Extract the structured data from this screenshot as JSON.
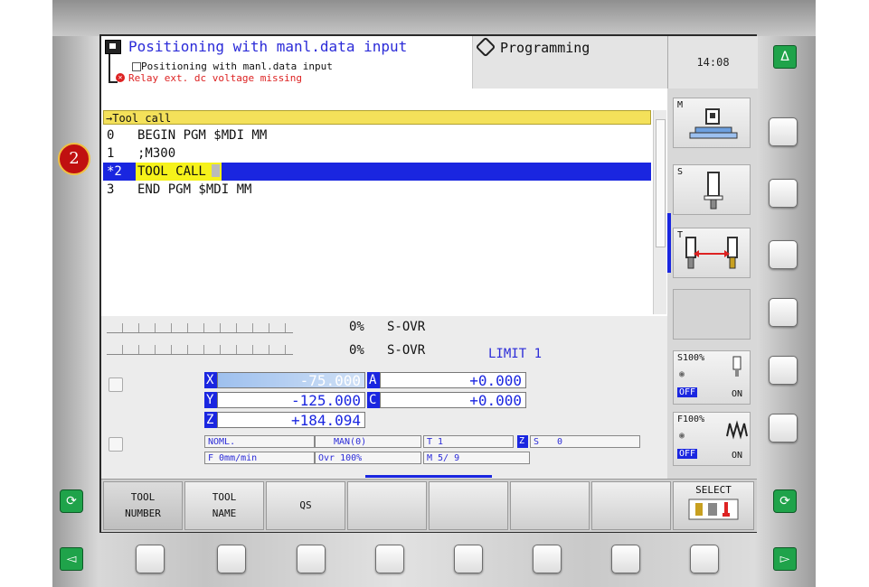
{
  "header": {
    "title": "Positioning with manl.data input",
    "subtitle": "Positioning with manl.data input",
    "error": "Relay ext. dc voltage missing",
    "mode": "Programming",
    "clock": "14:08"
  },
  "badge": "2",
  "editor": {
    "header": "→Tool call",
    "lines": [
      {
        "num": "0",
        "code": "BEGIN PGM $MDI MM"
      },
      {
        "num": "1",
        "code": ";M300"
      },
      {
        "num": "*2",
        "code": "TOOL CALL"
      },
      {
        "num": "3",
        "code": "END PGM $MDI MM"
      }
    ]
  },
  "override": {
    "row1_pct": "0%",
    "row1_label": "S-OVR",
    "row2_pct": "0%",
    "row2_label": "S-OVR",
    "limit": "LIMIT 1"
  },
  "axes": [
    {
      "axis": "X",
      "value": "-75.000"
    },
    {
      "axis": "Y",
      "value": "-125.000"
    },
    {
      "axis": "Z",
      "value": "+184.094"
    },
    {
      "axis": "A",
      "value": "+0.000"
    },
    {
      "axis": "C",
      "value": "+0.000"
    }
  ],
  "status": {
    "noml": "NOML.",
    "man": "MAN(0)",
    "tool": "T 1",
    "zaxis": "Z",
    "spindle": "S",
    "spindle_val": "0",
    "feed": "F 0mm/min",
    "ovr": "Ovr 100%",
    "m": "M 5/ 9"
  },
  "side": {
    "m_key": "M",
    "s_key": "S",
    "t_key": "T",
    "s_pct": "S100%",
    "f_pct": "F100%",
    "off": "OFF",
    "on": "ON"
  },
  "softkeys": [
    {
      "l1": "TOOL",
      "l2": "NUMBER"
    },
    {
      "l1": "TOOL",
      "l2": "NAME"
    },
    {
      "l1": "QS",
      "l2": ""
    },
    {
      "l1": "",
      "l2": ""
    },
    {
      "l1": "",
      "l2": ""
    },
    {
      "l1": "",
      "l2": ""
    },
    {
      "l1": "",
      "l2": ""
    }
  ],
  "select_label": "SELECT",
  "hw_glyphs": {
    "up": "Δ",
    "left": "◅",
    "right": "▻",
    "cycle": "⟳"
  },
  "colors": {
    "accent_blue": "#1a26e0",
    "highlight_yellow": "#f6f21a",
    "title_blue": "#2b2bd8",
    "error_red": "#d22",
    "green_key": "#1fa34a"
  }
}
